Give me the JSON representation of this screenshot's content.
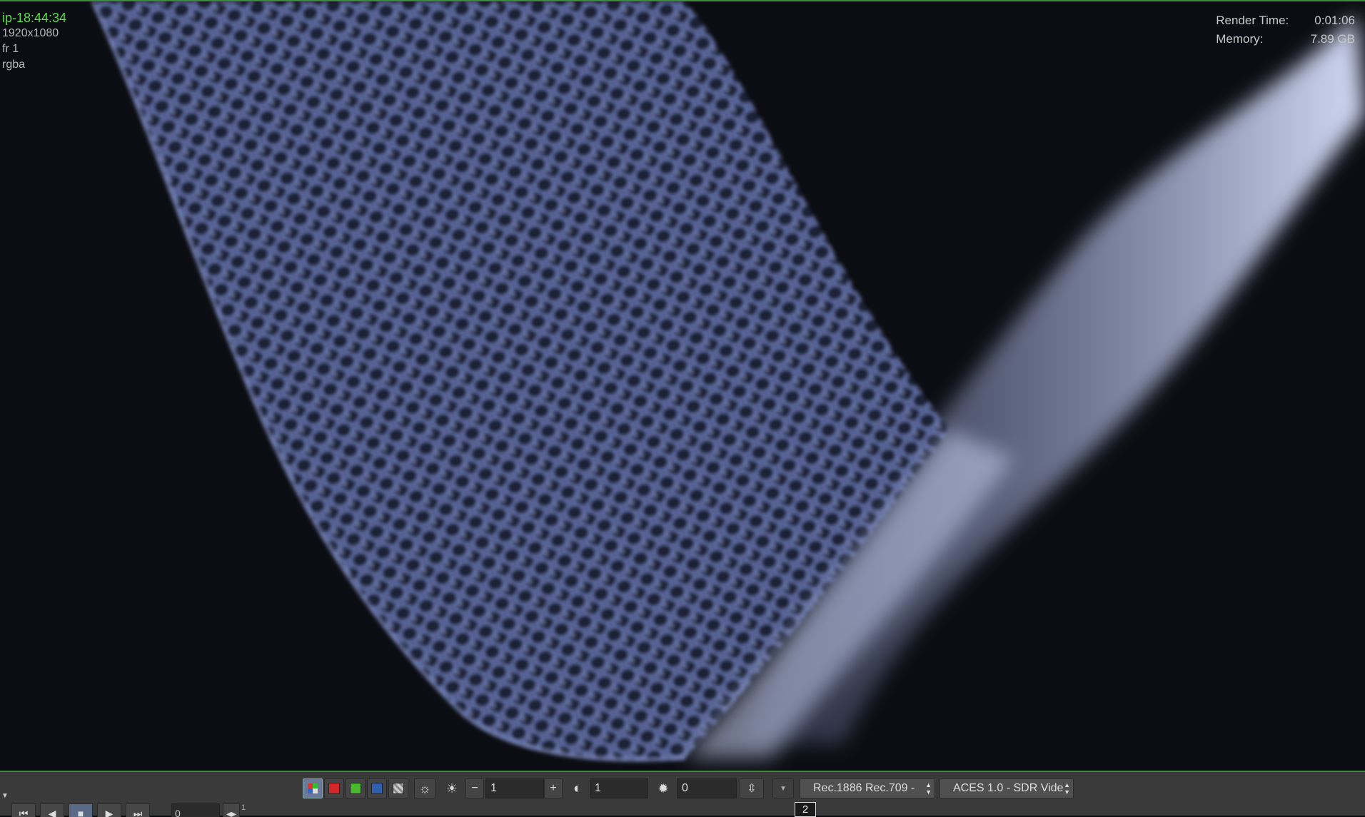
{
  "hud": {
    "title": "ip-18:44:34",
    "resolution": "1920x1080",
    "frame": "fr 1",
    "channels": "rgba",
    "render_time_label": "Render Time:",
    "render_time_value": "0:01:06",
    "memory_label": "Memory:",
    "memory_value": "7.89 GB"
  },
  "toolbar": {
    "channel_buttons": [
      {
        "name": "rgb",
        "color": "#c04848",
        "active": true
      },
      {
        "name": "red",
        "color": "#d42828"
      },
      {
        "name": "green",
        "color": "#4cb830"
      },
      {
        "name": "blue",
        "color": "#2f5fae"
      },
      {
        "name": "alpha",
        "color": "#b0b0b0"
      }
    ],
    "exposure_value": "1",
    "gamma_value": "1",
    "offset_value": "0",
    "display_dropdown": "Rec.1886 Rec.709 -",
    "view_dropdown": "ACES 1.0 - SDR Vide",
    "minus_label": "−",
    "plus_label": "+"
  },
  "transport": {
    "frame_value": "0",
    "page_badge": "2",
    "tiny_label": "1",
    "buttons": [
      "skip-start-icon",
      "step-back-icon",
      "stop-icon",
      "play-icon",
      "skip-end-icon"
    ]
  }
}
